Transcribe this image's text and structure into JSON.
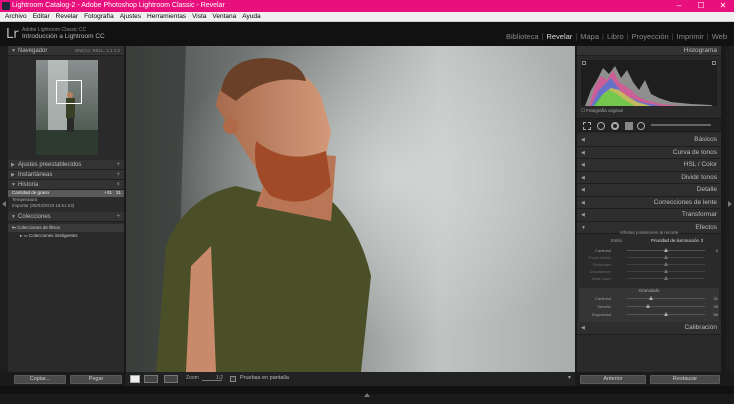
{
  "window": {
    "title": "Lightroom Catalog-2 - Adobe Photoshop Lightroom Classic - Revelar",
    "minimize": "–",
    "maximize": "☐",
    "close": "✕"
  },
  "menu": [
    "Archivo",
    "Editar",
    "Revelar",
    "Fotografía",
    "Ajustes",
    "Herramientas",
    "Vista",
    "Ventana",
    "Ayuda"
  ],
  "identity": {
    "logo": "Lr",
    "small": "Adobe Lightroom Classic CC",
    "name": "Introducción a Lightroom CC"
  },
  "modules": [
    "Biblioteca",
    "Revelar",
    "Mapa",
    "Libro",
    "Proyección",
    "Imprimir",
    "Web"
  ],
  "left": {
    "navigator": {
      "title": "Navegador",
      "zoom": "ENCAJ.   RELL.   1:1   1:2"
    },
    "panels": {
      "presets": "Ajustes preestablecidos",
      "snapshots": "Instantáneas",
      "history": "Historia",
      "collections": "Colecciones"
    },
    "history": [
      {
        "label": "Cantidad de grano",
        "a": "+31",
        "b": "31"
      },
      {
        "label": "Temperatura",
        "a": "",
        "b": ""
      },
      {
        "label": "Importar (05/03/2019 16:51:23)",
        "a": "",
        "b": ""
      }
    ],
    "collections": [
      "Colecciones de filtros",
      "Colecciones inteligentes"
    ],
    "copy": "Copiar...",
    "paste": "Pegar"
  },
  "toolbar": {
    "zoom_label": "Zoom",
    "zoom_value": "1:2",
    "proof": "Pruebas en pantalla"
  },
  "right": {
    "histogram": "Histograma",
    "original": "Fotografía original",
    "panels": [
      "Básicos",
      "Curva de tonos",
      "HSL / Color",
      "Dividir tonos",
      "Detalle",
      "Correcciones de lente",
      "Transformar",
      "Efectos"
    ],
    "effects": {
      "vignette_title": "Viñetas posteriores al recorte",
      "style_label": "Estilo",
      "style_value": "Prioridad de iluminación",
      "vignette_rows": [
        "Cantidad",
        "Punto medio",
        "Redondez",
        "Desvanecer",
        "Altas luces"
      ],
      "vignette_value": "0",
      "grain_title": "Granulado",
      "grain_rows": [
        {
          "label": "Cantidad",
          "value": "31"
        },
        {
          "label": "Tamaño",
          "value": "25"
        },
        {
          "label": "Rugosidad",
          "value": "50"
        }
      ]
    },
    "calibration": "Calibración",
    "previous": "Anterior",
    "reset": "Restaurar"
  },
  "colors": {
    "titlebar": "#e8107c",
    "panel": "#2a2a2a"
  }
}
